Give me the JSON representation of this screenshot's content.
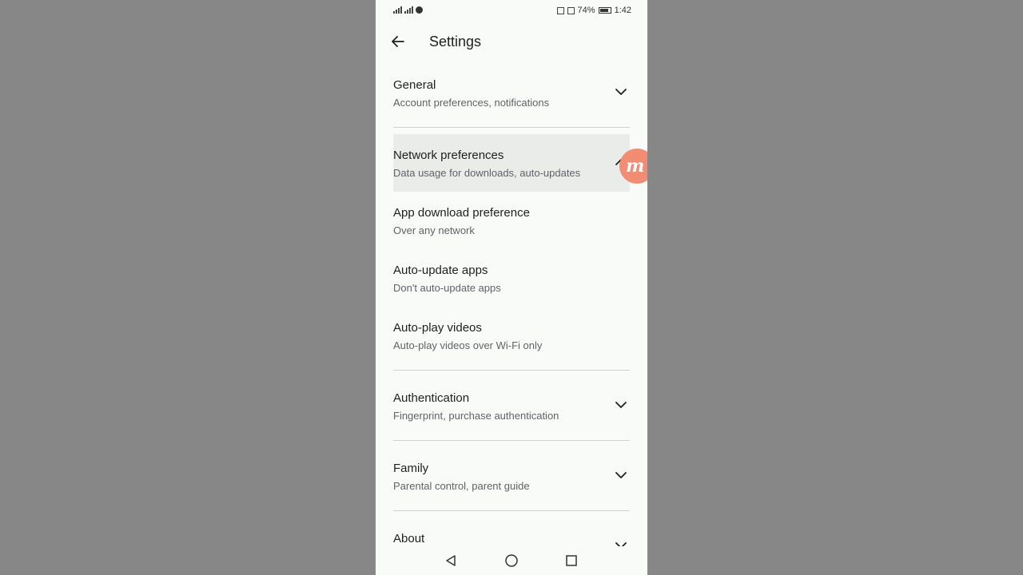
{
  "status_bar": {
    "battery_percent": "74%",
    "time": "1:42"
  },
  "app_bar": {
    "title": "Settings"
  },
  "sections": [
    {
      "title": "General",
      "subtitle": "Account preferences, notifications",
      "state": "collapsed"
    },
    {
      "title": "Network preferences",
      "subtitle": "Data usage for downloads, auto-updates",
      "state": "expanded"
    },
    {
      "title": "Authentication",
      "subtitle": "Fingerprint, purchase authentication",
      "state": "collapsed"
    },
    {
      "title": "Family",
      "subtitle": "Parental control, parent guide",
      "state": "collapsed"
    },
    {
      "title": "About",
      "subtitle": "",
      "state": "collapsed"
    }
  ],
  "network_items": [
    {
      "title": "App download preference",
      "value": "Over any network"
    },
    {
      "title": "Auto-update apps",
      "value": "Don't auto-update apps"
    },
    {
      "title": "Auto-play videos",
      "value": "Auto-play videos over Wi-Fi only"
    }
  ],
  "overlay_badge": {
    "letter": "m",
    "color": "#f28d74"
  },
  "icons": {
    "back": "arrow-left-icon",
    "expand": "chevron-down-icon",
    "collapse": "chevron-up-icon",
    "nav_back": "triangle-back-icon",
    "nav_home": "circle-home-icon",
    "nav_recents": "square-recents-icon"
  }
}
